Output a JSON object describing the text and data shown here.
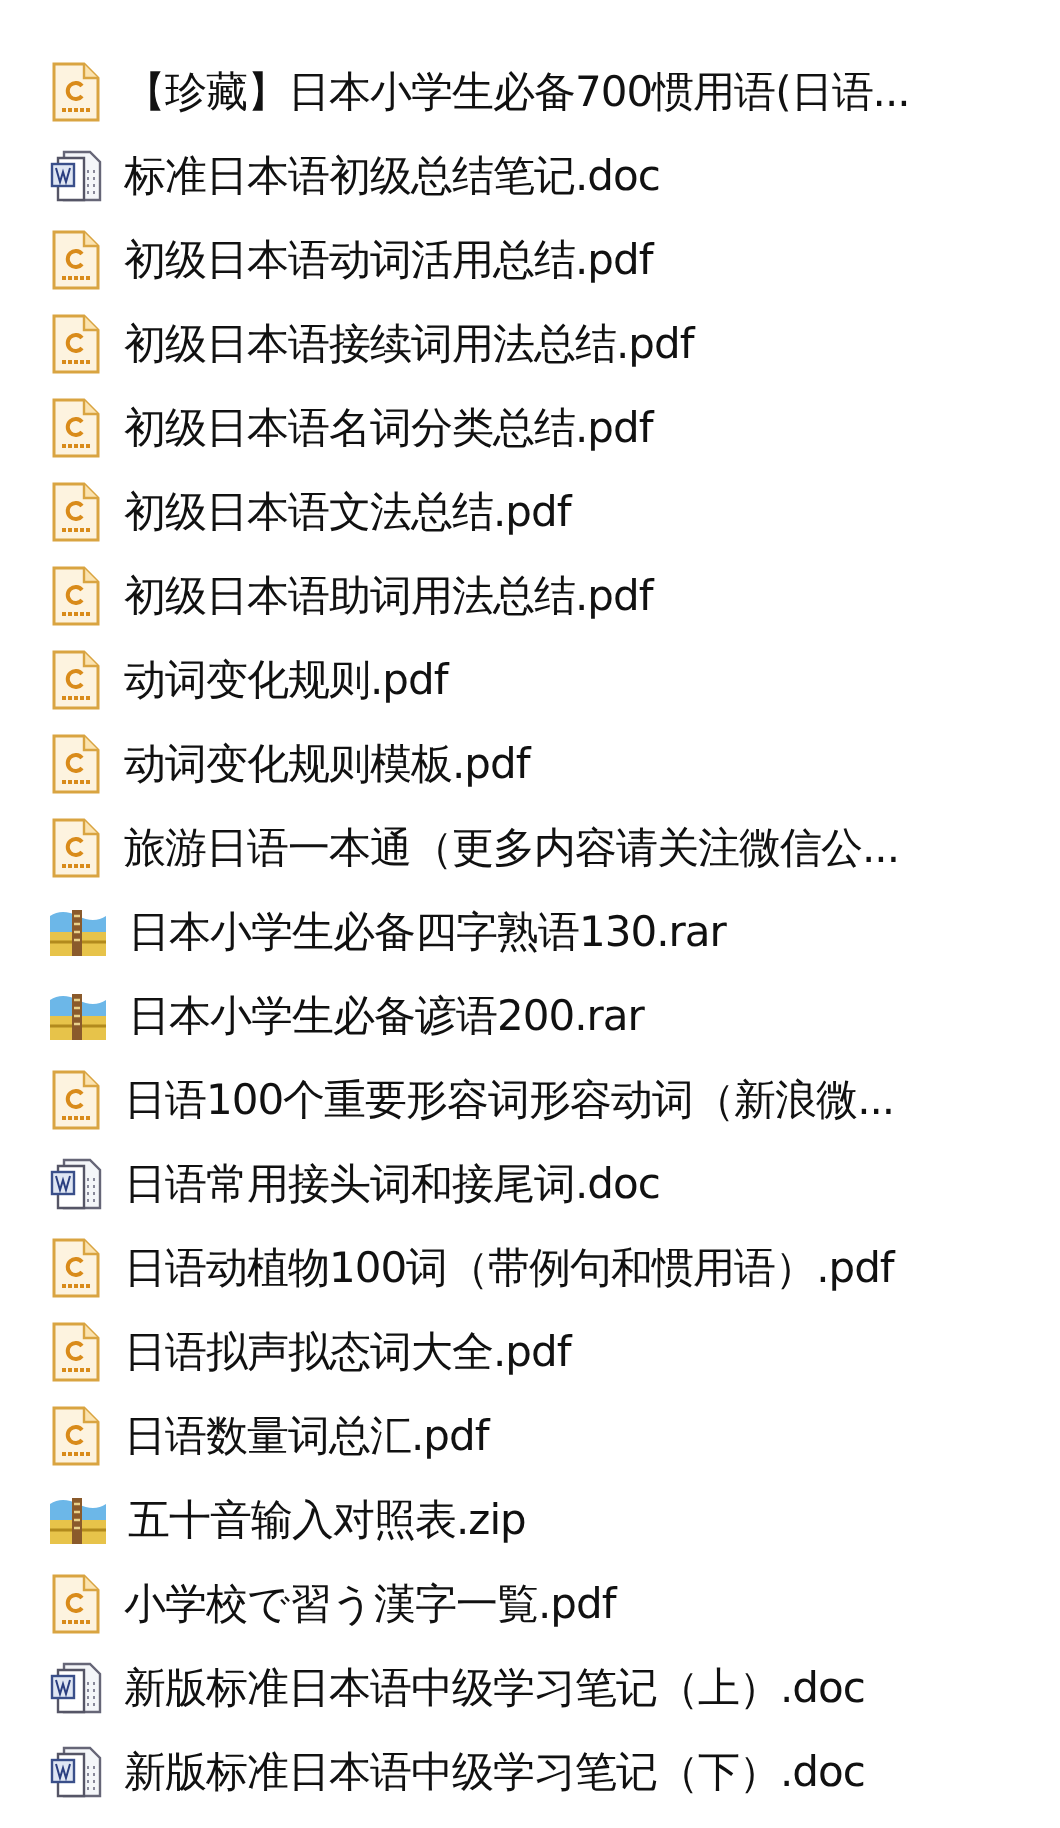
{
  "files": [
    {
      "kind": "pdf",
      "name": "【珍藏】日本小学生必备700惯用语(日语..."
    },
    {
      "kind": "doc",
      "name": "标准日本语初级总结笔记.doc"
    },
    {
      "kind": "pdf",
      "name": "初级日本语动词活用总结.pdf"
    },
    {
      "kind": "pdf",
      "name": "初级日本语接续词用法总结.pdf"
    },
    {
      "kind": "pdf",
      "name": "初级日本语名词分类总结.pdf"
    },
    {
      "kind": "pdf",
      "name": "初级日本语文法总结.pdf"
    },
    {
      "kind": "pdf",
      "name": "初级日本语助词用法总结.pdf"
    },
    {
      "kind": "pdf",
      "name": "动词变化规则.pdf"
    },
    {
      "kind": "pdf",
      "name": "动词变化规则模板.pdf"
    },
    {
      "kind": "pdf",
      "name": "旅游日语一本通（更多内容请关注微信公..."
    },
    {
      "kind": "archive",
      "name": "日本小学生必备四字熟语130.rar"
    },
    {
      "kind": "archive",
      "name": "日本小学生必备谚语200.rar"
    },
    {
      "kind": "pdf",
      "name": "日语100个重要形容词形容动词（新浪微..."
    },
    {
      "kind": "doc",
      "name": "日语常用接头词和接尾词.doc"
    },
    {
      "kind": "pdf",
      "name": "日语动植物100词（带例句和惯用语）.pdf"
    },
    {
      "kind": "pdf",
      "name": "日语拟声拟态词大全.pdf"
    },
    {
      "kind": "pdf",
      "name": "日语数量词总汇.pdf"
    },
    {
      "kind": "archive",
      "name": "五十音输入对照表.zip"
    },
    {
      "kind": "pdf",
      "name": "小学校で習う漢字一覧.pdf"
    },
    {
      "kind": "doc",
      "name": "新版标准日本语中级学习笔记（上）.doc"
    },
    {
      "kind": "doc",
      "name": "新版标准日本语中级学习笔记（下）.doc"
    }
  ]
}
